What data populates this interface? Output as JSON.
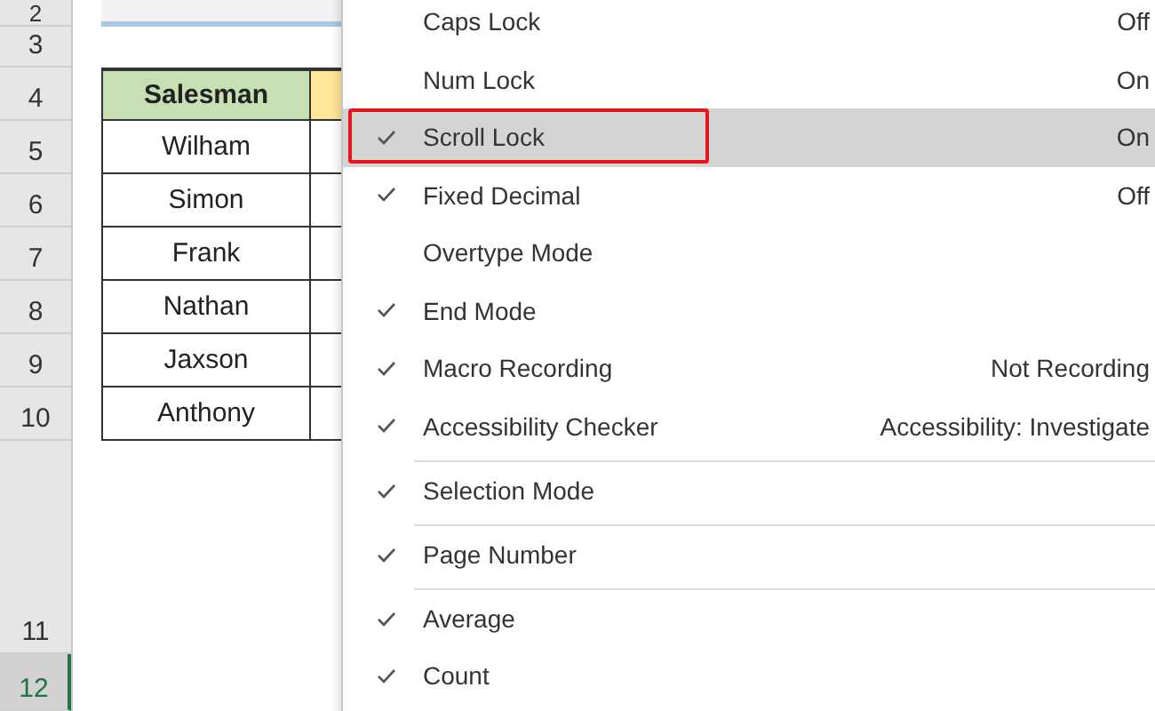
{
  "row_headers": [
    {
      "label": "2",
      "selected": false
    },
    {
      "label": "3",
      "selected": false
    },
    {
      "label": "4",
      "selected": false
    },
    {
      "label": "5",
      "selected": false
    },
    {
      "label": "6",
      "selected": false
    },
    {
      "label": "7",
      "selected": false
    },
    {
      "label": "8",
      "selected": false
    },
    {
      "label": "9",
      "selected": false
    },
    {
      "label": "10",
      "selected": false
    },
    {
      "label": "11",
      "selected": false
    },
    {
      "label": "12",
      "selected": true
    }
  ],
  "table": {
    "header": "Salesman",
    "rows": [
      "Wilham",
      "Simon",
      "Frank",
      "Nathan",
      "Jaxson",
      "Anthony"
    ]
  },
  "context_menu": {
    "items": [
      {
        "label": "Caps Lock",
        "value": "Off",
        "checked": false,
        "selected": false,
        "outlined": false,
        "separator_before": false
      },
      {
        "label": "Num Lock",
        "value": "On",
        "checked": false,
        "selected": false,
        "outlined": false,
        "separator_before": false
      },
      {
        "label": "Scroll Lock",
        "value": "On",
        "checked": true,
        "selected": true,
        "outlined": true,
        "separator_before": false
      },
      {
        "label": "Fixed Decimal",
        "value": "Off",
        "checked": true,
        "selected": false,
        "outlined": false,
        "separator_before": false
      },
      {
        "label": "Overtype Mode",
        "checked": false,
        "selected": false,
        "outlined": false,
        "separator_before": false
      },
      {
        "label": "End Mode",
        "checked": true,
        "selected": false,
        "outlined": false,
        "separator_before": false
      },
      {
        "label": "Macro Recording",
        "value": "Not Recording",
        "checked": true,
        "selected": false,
        "outlined": false,
        "separator_before": false
      },
      {
        "label": "Accessibility Checker",
        "value": "Accessibility: Investigate",
        "checked": true,
        "selected": false,
        "outlined": false,
        "separator_before": false
      },
      {
        "label": "Selection Mode",
        "checked": true,
        "selected": false,
        "outlined": false,
        "separator_before": true
      },
      {
        "label": "Page Number",
        "checked": true,
        "selected": false,
        "outlined": false,
        "separator_before": true
      },
      {
        "label": "Average",
        "checked": true,
        "selected": false,
        "outlined": false,
        "separator_before": true
      },
      {
        "label": "Count",
        "checked": true,
        "selected": false,
        "outlined": false,
        "separator_before": false
      }
    ]
  }
}
